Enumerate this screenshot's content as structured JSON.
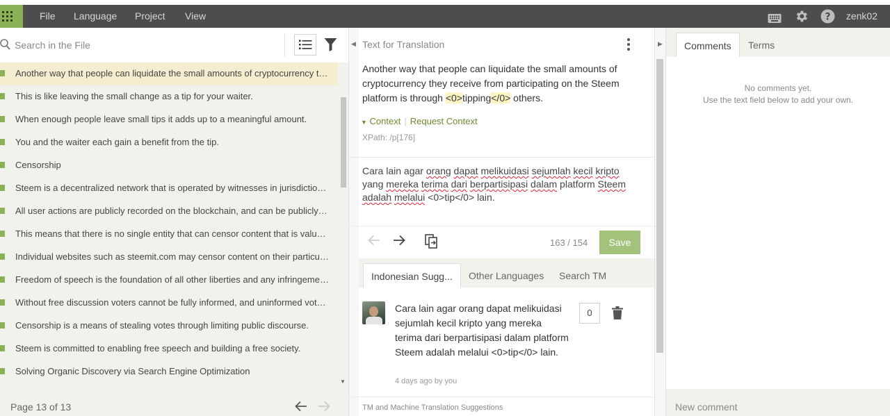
{
  "menu": {
    "file": "File",
    "language": "Language",
    "project": "Project",
    "view": "View"
  },
  "user": {
    "name": "zenk02"
  },
  "left": {
    "search_placeholder": "Search in the File",
    "segments": [
      "Another way that people can liquidate the small amounts of cryptocurrency they receive from participating on the Steem platform is through tipping others.",
      "This is like leaving the small change as a tip for your waiter.",
      "When enough people leave small tips it adds up to a meaningful amount.",
      "You and the waiter each gain a benefit from the tip.",
      "Censorship",
      "Steem is a decentralized network that is operated by witnesses in jurisdictions around the world.",
      "All user actions are publicly recorded on the blockchain, and can be publicly viewed.",
      "This means that there is no single entity that can censor content that is valued by the community.",
      "Individual websites such as steemit.com may censor content on their particular websites.",
      "Freedom of speech is the foundation of all other liberties and any infringement upon it is harmful.",
      "Without free discussion voters cannot be fully informed, and uninformed voters make poor decisions.",
      "Censorship is a means of stealing votes through limiting public discourse.",
      "Steem is committed to enabling free speech and building a free society.",
      "Solving Organic Discovery via Search Engine Optimization"
    ],
    "pager": "Page 13 of 13"
  },
  "source": {
    "heading": "Text for Translation",
    "text_before": "Another way that people can liquidate the small amounts of cryptocurrency they receive from participating on the Steem platform is through ",
    "tag_open": "<0>",
    "tag_word": "tipping",
    "tag_close": "</0>",
    "text_after": " others.",
    "context_label": "Context",
    "request_context": "Request Context",
    "xpath": "XPath: /p[176]"
  },
  "target": {
    "words": [
      {
        "t": "Cara lain agar ",
        "sq": false
      },
      {
        "t": "orang",
        "sq": true
      },
      {
        "t": " ",
        "sq": false
      },
      {
        "t": "dapat",
        "sq": true
      },
      {
        "t": " ",
        "sq": false
      },
      {
        "t": "melikuidasi",
        "sq": true
      },
      {
        "t": " ",
        "sq": false
      },
      {
        "t": "sejumlah",
        "sq": true
      },
      {
        "t": " ",
        "sq": false
      },
      {
        "t": "kecil",
        "sq": true
      },
      {
        "t": " ",
        "sq": false
      },
      {
        "t": "kripto",
        "sq": true
      },
      {
        "t": " yang ",
        "sq": false
      },
      {
        "t": "mereka",
        "sq": true
      },
      {
        "t": " ",
        "sq": false
      },
      {
        "t": "terima",
        "sq": true
      },
      {
        "t": " ",
        "sq": false
      },
      {
        "t": "dari",
        "sq": true
      },
      {
        "t": " ",
        "sq": false
      },
      {
        "t": "berpartisipasi",
        "sq": true
      },
      {
        "t": " ",
        "sq": false
      },
      {
        "t": "dalam",
        "sq": true
      },
      {
        "t": " platform ",
        "sq": false
      },
      {
        "t": "Steem",
        "sq": true
      },
      {
        "t": " ",
        "sq": false
      },
      {
        "t": "adalah",
        "sq": true
      },
      {
        "t": " ",
        "sq": false
      },
      {
        "t": "melalui",
        "sq": true
      },
      {
        "t": " <0>tip</0> lain.",
        "sq": false
      }
    ],
    "count": "163 / 154",
    "save_label": "Save"
  },
  "suggestion_tabs": [
    "Indonesian Sugg...",
    "Other Languages",
    "Search TM"
  ],
  "suggestion": {
    "text": "Cara lain agar orang dapat melikuidasi sejumlah kecil kripto yang mereka terima dari berpartisipasi dalam platform Steem adalah melalui <0>tip</0> lain.",
    "meta": "4 days ago by you",
    "votes": "0"
  },
  "tm_footer": "TM and Machine Translation Suggestions",
  "right": {
    "tabs": [
      "Comments",
      "Terms"
    ],
    "empty_line1": "No comments yet.",
    "empty_line2": "Use the text field below to add your own.",
    "new_comment": "New comment"
  },
  "colors": {
    "accent_green": "#8bb257",
    "topbar": "#4d4d4d",
    "active_row": "#f4edcf",
    "save_button": "#a3c27c"
  }
}
